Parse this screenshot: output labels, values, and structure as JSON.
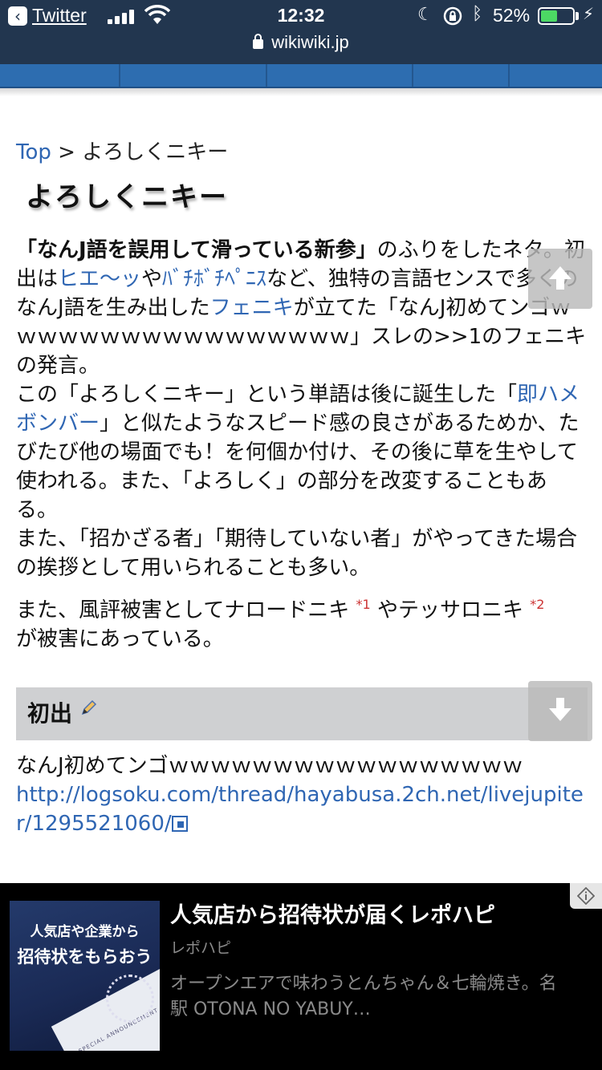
{
  "status_bar": {
    "back_app": "Twitter",
    "time": "12:32",
    "battery_percent": "52%",
    "battery_level": 0.52,
    "url": "wikiwiki.jp"
  },
  "breadcrumb": {
    "top": "Top",
    "sep": " > ",
    "current": "よろしくニキー"
  },
  "page_title": "よろしくニキー",
  "para1": {
    "bold_quote": "「なんJ語を誤用して滑っている新参」",
    "t1": "のふりをしたネタ。初出は",
    "link1": "ヒエ〜ッ",
    "t2": "や",
    "link2": "ﾊﾞﾁﾎﾞﾁﾍﾟﾆｽ",
    "t3": "など、独特の言語センスで多くのなんJ語を生み出した",
    "link3": "フェニキ",
    "t4": "が立てた「なんJ初めてンゴｗｗｗｗｗｗｗｗｗｗｗｗｗｗｗｗｗ」スレの>>1のフェニキの発言。",
    "t5": "この「よろしくニキー」という単語は後に誕生した「",
    "link4": "即ハメボンバー",
    "t6": "」と似たようなスピード感の良さがあるためか、たびたび他の場面でも！を何個か付け、その後に草を生やして使われる。また、「よろしく」の部分を改変することもある。",
    "t7": "また、「招かざる者」「期待していない者」がやってきた場合の挨拶として用いられることも多い。"
  },
  "para2": {
    "t1": "また、風評被害としてナロードニキ",
    "fn1": "*1",
    "t2": "やテッサロニキ",
    "fn2": "*2",
    "t3": "が被害にあっている。"
  },
  "section": {
    "heading": "初出",
    "text": "なんJ初めてンゴｗｗｗｗｗｗｗｗｗｗｗｗｗｗｗｗｗ",
    "url": "http://logsoku.com/thread/hayabusa.2ch.net/livejupiter/1295521060/"
  },
  "ad": {
    "image_line1": "人気店や企業から",
    "image_line2": "招待状をもらおう",
    "image_card_text": "SPECIAL ANNOUNCEMENT",
    "title": "人気店から招待状が届くレポハピ",
    "source": "レポハピ",
    "description": "オープンエアで味わうとんちゃん＆七輪焼き。名駅 OTONA NO YABUY…"
  },
  "icons": {
    "back": "back-arrow-icon",
    "signal": "cell-signal-icon",
    "wifi": "wifi-icon",
    "moon": "do-not-disturb-icon",
    "rotation_lock": "rotation-lock-icon",
    "bluetooth": "bluetooth-icon",
    "battery": "battery-icon",
    "charging": "charging-bolt-icon",
    "lock": "secure-lock-icon",
    "pencil": "edit-pencil-icon",
    "external": "external-link-icon",
    "scroll_up": "scroll-up-arrow-icon",
    "scroll_down": "scroll-down-arrow-icon",
    "ad_info": "ad-info-icon"
  },
  "colors": {
    "status_bg": "#22364f",
    "nav_bg": "#2d6db0",
    "link": "#2f66b3",
    "section_bg": "#cfd0d2",
    "battery": "#4cd964",
    "footnote": "#cc3333"
  }
}
